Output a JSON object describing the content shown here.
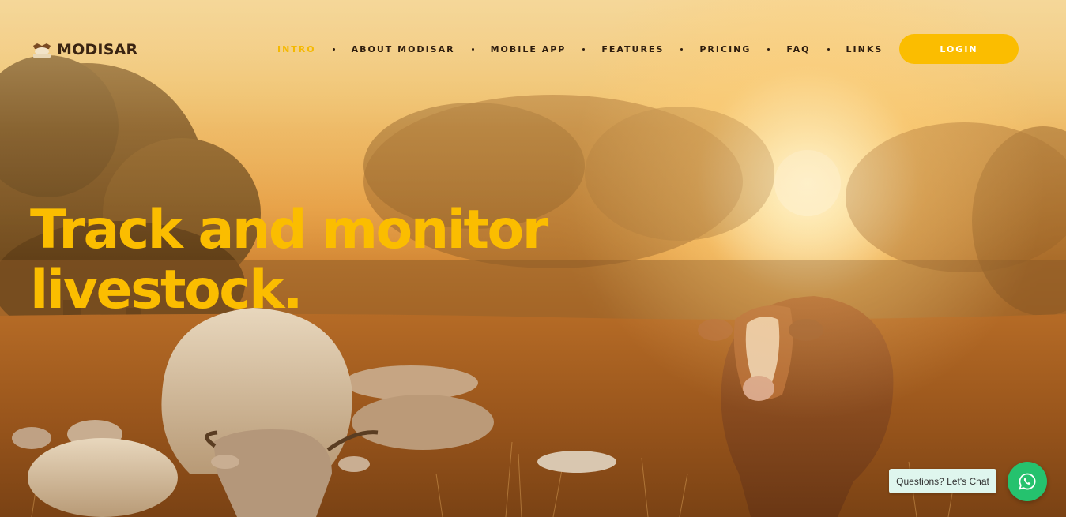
{
  "brand": {
    "name": "MODISAR",
    "logo_icon": "cattle-emblem-icon",
    "logo_caption": "MODISAR"
  },
  "nav": {
    "items": [
      {
        "label": "INTRO",
        "active": true
      },
      {
        "label": "ABOUT MODISAR",
        "active": false
      },
      {
        "label": "MOBILE APP",
        "active": false
      },
      {
        "label": "FEATURES",
        "active": false
      },
      {
        "label": "PRICING",
        "active": false
      },
      {
        "label": "FAQ",
        "active": false
      },
      {
        "label": "LINKS",
        "active": false
      }
    ],
    "login_label": "LOGIN"
  },
  "hero": {
    "headline_line1": "Track and monitor",
    "headline_line2": "livestock.",
    "background": "sunset-pasture-with-cattle-photo"
  },
  "chat": {
    "bubble_text": "Questions? Let's Chat",
    "icon": "whatsapp-icon"
  },
  "colors": {
    "accent": "#fbbd00",
    "nav_text": "#2d1c0e",
    "brand_text": "#3a2412",
    "chat_green": "#25c26e",
    "chat_bubble_bg": "#dff6ee"
  }
}
